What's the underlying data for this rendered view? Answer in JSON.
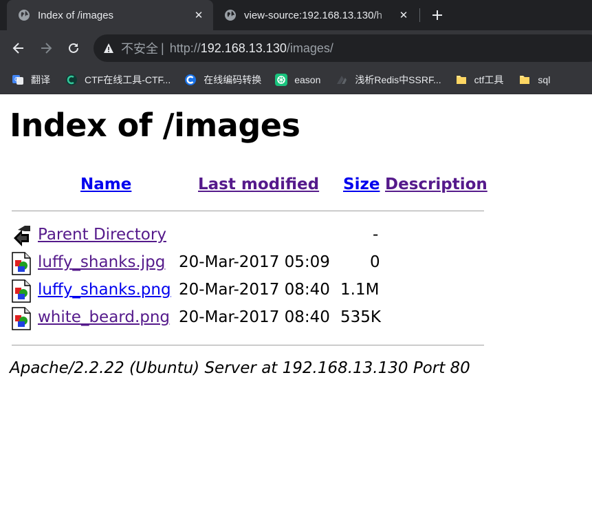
{
  "browser": {
    "tabs": [
      {
        "title": "Index of /images",
        "active": true
      },
      {
        "title": "view-source:192.168.13.130/h",
        "active": false
      }
    ],
    "address": {
      "security_label": "不安全",
      "scheme": "http://",
      "host": "192.168.13.130",
      "path": "/images/"
    },
    "bookmarks": [
      {
        "label": "翻译",
        "icon": "translate-icon"
      },
      {
        "label": "CTF在线工具-CTF...",
        "icon": "ctf-tools-icon"
      },
      {
        "label": "在线编码转换",
        "icon": "encode-icon"
      },
      {
        "label": "eason",
        "icon": "openai-icon"
      },
      {
        "label": "浅析Redis中SSRF...",
        "icon": "article-icon"
      },
      {
        "label": "ctf工具",
        "icon": "folder-icon"
      },
      {
        "label": "sql",
        "icon": "folder-icon"
      }
    ]
  },
  "page": {
    "title": "Index of /images",
    "columns": {
      "name": "Name",
      "last_modified": "Last modified",
      "size": "Size",
      "description": "Description"
    },
    "rows": [
      {
        "name": "Parent Directory",
        "modified": "",
        "size": "-",
        "icon": "back-arrow-icon"
      },
      {
        "name": "luffy_shanks.jpg",
        "modified": "20-Mar-2017 05:09",
        "size": "0",
        "icon": "image-file-icon"
      },
      {
        "name": "luffy_shanks.png",
        "modified": "20-Mar-2017 08:40",
        "size": "1.1M",
        "icon": "image-file-icon"
      },
      {
        "name": "white_beard.png",
        "modified": "20-Mar-2017 08:40",
        "size": "535K",
        "icon": "image-file-icon"
      }
    ],
    "footer": "Apache/2.2.22 (Ubuntu) Server at 192.168.13.130 Port 80"
  }
}
